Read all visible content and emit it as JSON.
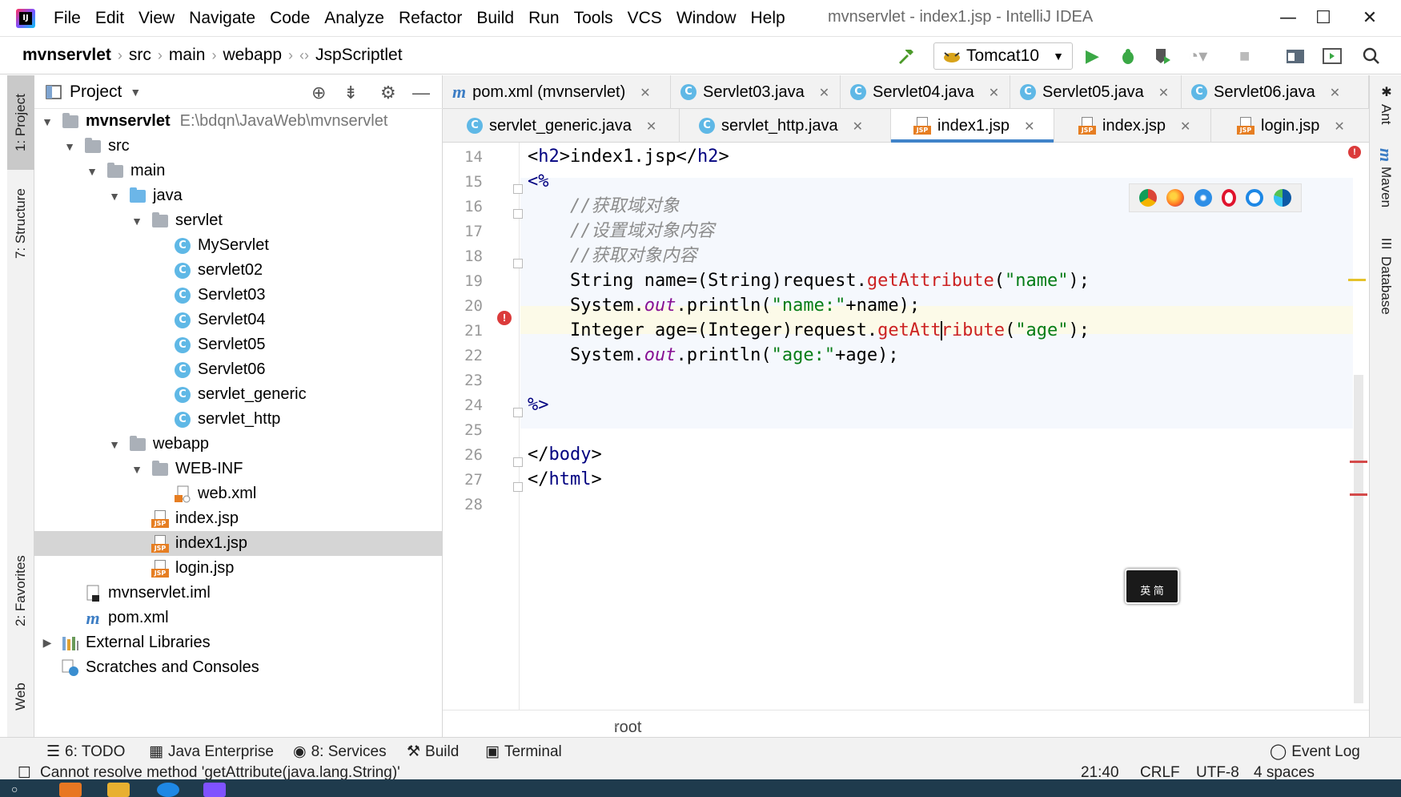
{
  "menubar": {
    "items": [
      "File",
      "Edit",
      "View",
      "Navigate",
      "Code",
      "Analyze",
      "Refactor",
      "Build",
      "Run",
      "Tools",
      "VCS",
      "Window",
      "Help"
    ],
    "title": "mvnservlet - index1.jsp - IntelliJ IDEA",
    "minimize": "—",
    "maximize": "☐",
    "close": "✕"
  },
  "navbar": {
    "crumbs": [
      "mvnservlet",
      "src",
      "main",
      "webapp",
      "JspScriptlet"
    ],
    "run_config": "Tomcat10"
  },
  "left_strip": {
    "project": "1: Project",
    "structure": "7: Structure",
    "favorites": "2: Favorites",
    "web": "Web"
  },
  "right_strip": {
    "ant": "Ant",
    "maven": "Maven",
    "database": "Database"
  },
  "project_panel": {
    "title": "Project",
    "tree": [
      {
        "label": "mvnservlet",
        "path": "E:\\bdqn\\JavaWeb\\mvnservlet"
      },
      {
        "label": "src"
      },
      {
        "label": "main"
      },
      {
        "label": "java"
      },
      {
        "label": "servlet"
      },
      {
        "label": "MyServlet"
      },
      {
        "label": "servlet02"
      },
      {
        "label": "Servlet03"
      },
      {
        "label": "Servlet04"
      },
      {
        "label": "Servlet05"
      },
      {
        "label": "Servlet06"
      },
      {
        "label": "servlet_generic"
      },
      {
        "label": "servlet_http"
      },
      {
        "label": "webapp"
      },
      {
        "label": "WEB-INF"
      },
      {
        "label": "web.xml"
      },
      {
        "label": "index.jsp"
      },
      {
        "label": "index1.jsp"
      },
      {
        "label": "login.jsp"
      },
      {
        "label": "mvnservlet.iml"
      },
      {
        "label": "pom.xml"
      },
      {
        "label": "External Libraries"
      },
      {
        "label": "Scratches and Consoles"
      }
    ]
  },
  "tabs_row1": [
    {
      "label": "pom.xml (mvnservlet)"
    },
    {
      "label": "Servlet03.java"
    },
    {
      "label": "Servlet04.java"
    },
    {
      "label": "Servlet05.java"
    },
    {
      "label": "Servlet06.java"
    }
  ],
  "tabs_row2": [
    {
      "label": "servlet_generic.java"
    },
    {
      "label": "servlet_http.java"
    },
    {
      "label": "index1.jsp"
    },
    {
      "label": "index.jsp"
    },
    {
      "label": "login.jsp"
    }
  ],
  "editor": {
    "line_numbers": [
      "14",
      "15",
      "16",
      "17",
      "18",
      "19",
      "20",
      "21",
      "22",
      "23",
      "24",
      "25",
      "26",
      "27",
      "28"
    ],
    "comments": [
      "//获取域对象",
      "//设置域对象内容",
      "//获取对象内容"
    ],
    "ime_label": "英 简",
    "breadcrumb": "root"
  },
  "bottom_tools": {
    "todo": "6: TODO",
    "java_enterprise": "Java Enterprise",
    "services": "8: Services",
    "build": "Build",
    "terminal": "Terminal",
    "event_log": "Event Log"
  },
  "statusbar": {
    "message": "Cannot resolve method 'getAttribute(java.lang.String)'",
    "position": "21:40",
    "line_sep": "CRLF",
    "encoding": "UTF-8",
    "indent": "4 spaces"
  },
  "colors": {
    "accent": "#4083c9",
    "tab_active_underline": "#4083c9",
    "string": "#067d17",
    "method_error": "#cc2222",
    "tag": "#000080"
  }
}
